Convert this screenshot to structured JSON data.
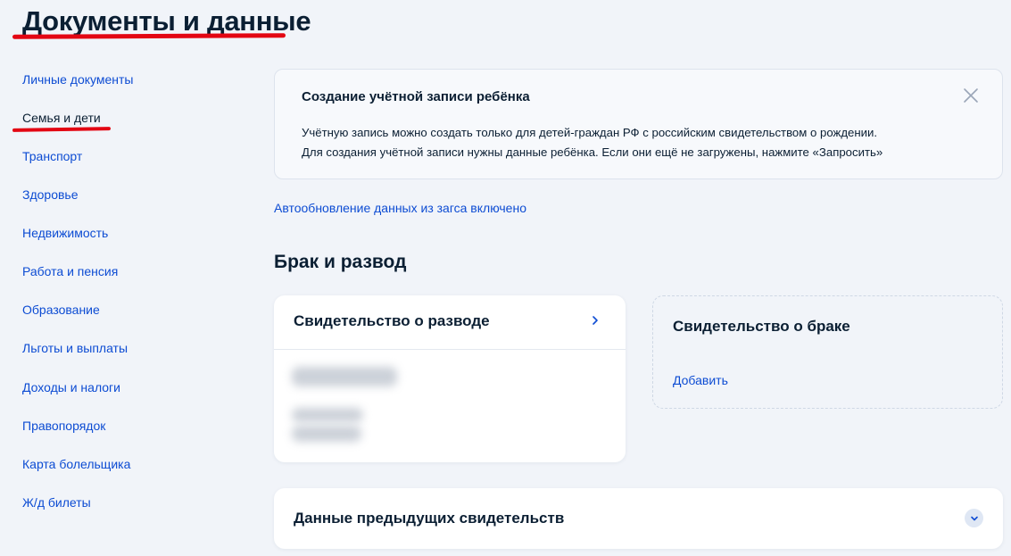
{
  "header": {
    "title": "Документы и данные"
  },
  "sidebar": {
    "items": [
      {
        "label": "Личные документы"
      },
      {
        "label": "Семья и дети",
        "active": true
      },
      {
        "label": "Транспорт"
      },
      {
        "label": "Здоровье"
      },
      {
        "label": "Недвижимость"
      },
      {
        "label": "Работа и пенсия"
      },
      {
        "label": "Образование"
      },
      {
        "label": "Льготы и выплаты"
      },
      {
        "label": "Доходы и налоги"
      },
      {
        "label": "Правопорядок"
      },
      {
        "label": "Карта болельщика"
      },
      {
        "label": "Ж/д билеты"
      }
    ]
  },
  "banner": {
    "title": "Создание учётной записи ребёнка",
    "line1": "Учётную запись можно создать только для детей-граждан РФ с российским свидетельством о рождении.",
    "line2": "Для создания учётной записи нужны данные ребёнка. Если они ещё не загружены, нажмите «Запросить»",
    "close_icon": "close-icon"
  },
  "auto_update": "Автообновление данных из загса включено",
  "section": {
    "title": "Брак и развод"
  },
  "cards": {
    "divorce": {
      "title": "Свидетельство о разводе",
      "icon": "chevron-right-icon"
    },
    "marriage": {
      "title": "Свидетельство о браке",
      "add_label": "Добавить"
    },
    "previous": {
      "title": "Данные предыдущих свидетельств",
      "icon": "chevron-down-icon"
    }
  },
  "colors": {
    "link": "#0d4cd3",
    "text": "#0b1f33",
    "accent_red": "#e30613",
    "background": "#f1f4f9"
  }
}
